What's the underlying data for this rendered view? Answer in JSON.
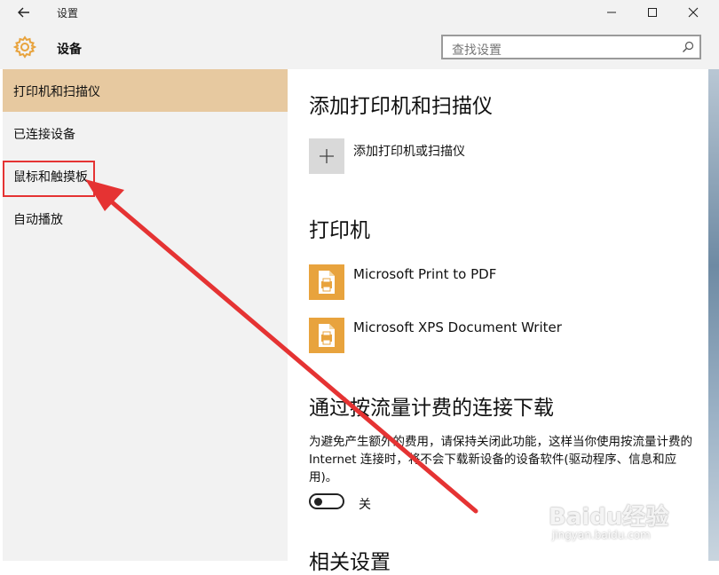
{
  "window": {
    "title": "设置",
    "back_icon": "back-arrow-icon",
    "controls": [
      "minimize-icon",
      "maximize-icon",
      "close-icon"
    ]
  },
  "header": {
    "title": "设备",
    "icon": "gear-icon",
    "search_placeholder": "查找设置"
  },
  "sidebar": {
    "items": [
      {
        "label": "打印机和扫描仪",
        "active": true
      },
      {
        "label": "已连接设备",
        "active": false
      },
      {
        "label": "鼠标和触摸板",
        "active": false
      },
      {
        "label": "自动播放",
        "active": false
      }
    ]
  },
  "main": {
    "add_section": {
      "heading": "添加打印机和扫描仪",
      "add_label": "添加打印机或扫描仪"
    },
    "printers_section": {
      "heading": "打印机",
      "printers": [
        {
          "name": "Microsoft Print to PDF"
        },
        {
          "name": "Microsoft XPS Document Writer"
        }
      ]
    },
    "metered_section": {
      "heading": "通过按流量计费的连接下载",
      "description": "为避免产生额外的费用，请保持关闭此功能，这样当你使用按流量计费的 Internet 连接时，将不会下载新设备的设备软件(驱动程序、信息和应用)。",
      "toggle_label": "关",
      "toggle_on": false
    },
    "related_heading": "相关设置"
  },
  "annotation": {
    "color": "#e53333"
  },
  "watermark": {
    "text": "Baidu经验",
    "sub": "jingyan.baidu.com"
  }
}
